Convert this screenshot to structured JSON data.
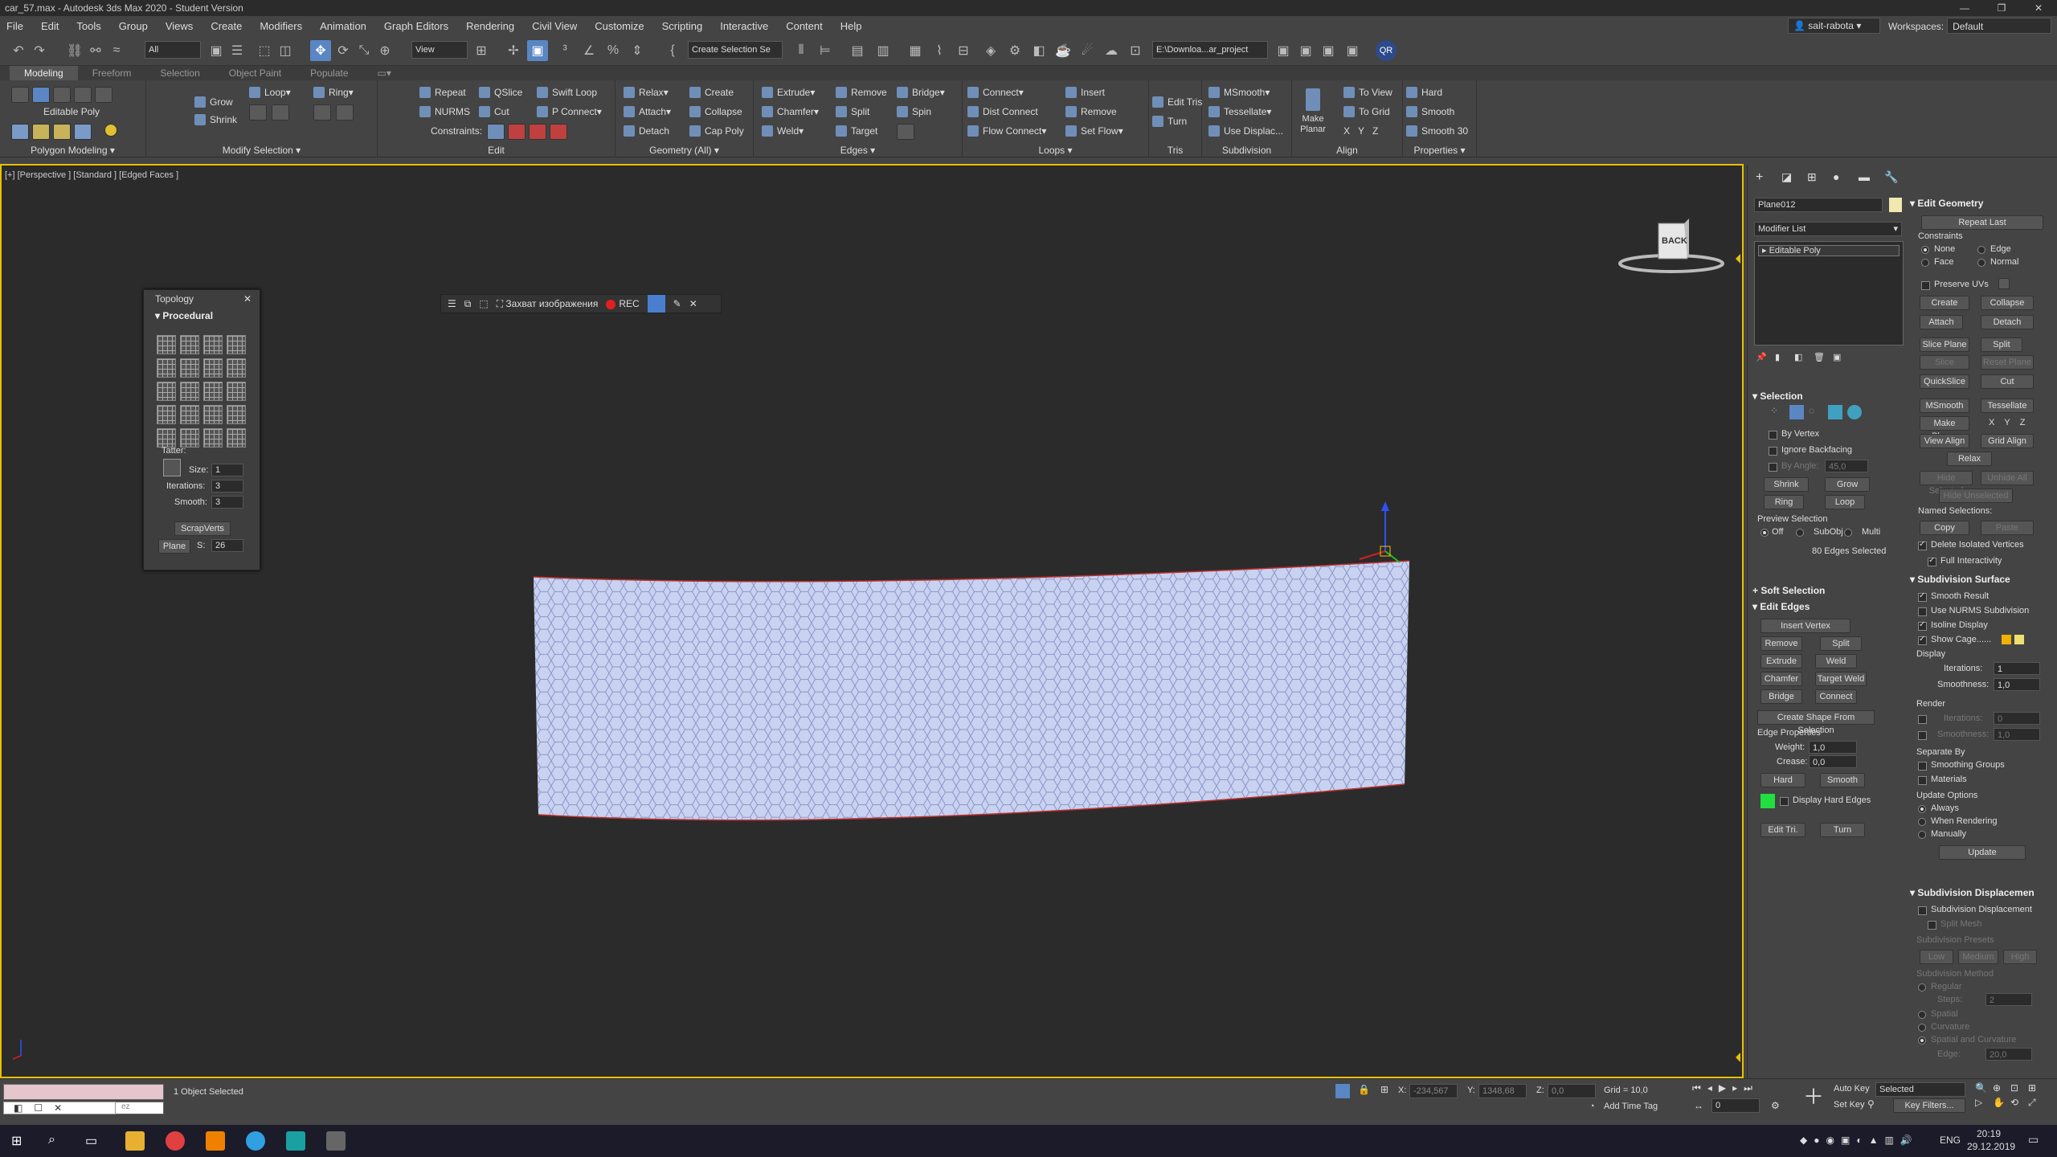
{
  "window": {
    "title": "car_57.max - Autodesk 3ds Max 2020 - Student Version"
  },
  "menu": {
    "items": [
      "File",
      "Edit",
      "Tools",
      "Group",
      "Views",
      "Create",
      "Modifiers",
      "Animation",
      "Graph Editors",
      "Rendering",
      "Civil View",
      "Customize",
      "Scripting",
      "Interactive",
      "Content",
      "Help"
    ],
    "user": "sait-rabota",
    "workspaces_label": "Workspaces:",
    "workspace": "Default"
  },
  "toolbar": {
    "filter": "All",
    "refcoord": "View",
    "selection_set": "Create Selection Se",
    "project_path": "E:\\Downloa...ar_project"
  },
  "ribbon_tabs": [
    "Modeling",
    "Freeform",
    "Selection",
    "Object Paint",
    "Populate"
  ],
  "ribbon": {
    "polygon_modeling": {
      "label": "Polygon Modeling",
      "mode": "Editable Poly"
    },
    "modify_selection": {
      "label": "Modify Selection",
      "grow": "Grow",
      "shrink": "Shrink",
      "loop": "Loop",
      "ring": "Ring"
    },
    "edit": {
      "label": "Edit",
      "repeat": "Repeat",
      "qslice": "QSlice",
      "swift_loop": "Swift Loop",
      "nurms": "NURMS",
      "cut": "Cut",
      "p_connect": "P Connect",
      "constraints": "Constraints:"
    },
    "geometry": {
      "label": "Geometry (All)",
      "relax": "Relax",
      "create": "Create",
      "attach": "Attach",
      "collapse": "Collapse",
      "detach": "Detach",
      "cap_poly": "Cap Poly"
    },
    "edges": {
      "label": "Edges",
      "extrude": "Extrude",
      "remove": "Remove",
      "bridge": "Bridge",
      "chamfer": "Chamfer",
      "split": "Split",
      "spin": "Spin",
      "weld": "Weld",
      "target": "Target"
    },
    "loops": {
      "label": "Loops",
      "connect": "Connect",
      "insert": "Insert",
      "dist_connect": "Dist Connect",
      "remove": "Remove",
      "flow_connect": "Flow Connect",
      "set_flow": "Set Flow"
    },
    "tris": {
      "label": "Tris",
      "edit_tris": "Edit Tris",
      "turn": "Turn"
    },
    "subdivision": {
      "label": "Subdivision",
      "msmooth": "MSmooth",
      "tessellate": "Tessellate",
      "use_displace": "Use Displac..."
    },
    "align": {
      "label": "Align",
      "make_planar": "Make Planar",
      "to_view": "To View",
      "to_grid": "To Grid",
      "x": "X",
      "y": "Y",
      "z": "Z"
    },
    "properties": {
      "label": "Properties",
      "hard": "Hard",
      "smooth": "Smooth",
      "smooth30": "Smooth 30"
    }
  },
  "viewport": {
    "label": "[+] [Perspective ] [Standard ] [Edged Faces ]",
    "navcube_face": "BACK"
  },
  "topology": {
    "title": "Topology",
    "section": "Procedural",
    "tatter": "Tatter:",
    "size_label": "Size:",
    "size": "1",
    "iterations_label": "Iterations:",
    "iterations": "3",
    "smooth_label": "Smooth:",
    "smooth": "3",
    "scrapverts": "ScrapVerts",
    "plane": "Plane",
    "s_label": "S:",
    "s": "26"
  },
  "floatbar": {
    "capture": "Захват изображения",
    "rec": "REC"
  },
  "command_panel": {
    "object_name": "Plane012",
    "modifier_list": "Modifier List",
    "stack_item": "Editable Poly",
    "selection": {
      "title": "Selection",
      "by_vertex": "By Vertex",
      "ignore_backfacing": "Ignore Backfacing",
      "by_angle": "By Angle:",
      "angle": "45,0",
      "shrink": "Shrink",
      "grow": "Grow",
      "ring": "Ring",
      "loop": "Loop",
      "preview": "Preview Selection",
      "off": "Off",
      "subobj": "SubObj",
      "multi": "Multi",
      "status": "80 Edges Selected"
    },
    "soft_selection": "Soft Selection",
    "edit_edges": {
      "title": "Edit Edges",
      "insert_vertex": "Insert Vertex",
      "remove": "Remove",
      "split": "Split",
      "extrude": "Extrude",
      "weld": "Weld",
      "chamfer": "Chamfer",
      "target_weld": "Target Weld",
      "bridge": "Bridge",
      "connect": "Connect",
      "create_shape": "Create Shape From Selection",
      "edge_properties": "Edge Properties",
      "weight_label": "Weight:",
      "weight": "1,0",
      "crease_label": "Crease:",
      "crease": "0,0",
      "hard": "Hard",
      "smooth": "Smooth",
      "display_hard": "Display Hard Edges",
      "edit_tri": "Edit Tri.",
      "turn": "Turn"
    },
    "edit_geometry": {
      "title": "Edit Geometry",
      "repeat_last": "Repeat Last",
      "constraints": "Constraints",
      "none": "None",
      "edge": "Edge",
      "face": "Face",
      "normal": "Normal",
      "preserve_uvs": "Preserve UVs",
      "create": "Create",
      "collapse": "Collapse",
      "attach": "Attach",
      "detach": "Detach",
      "slice_plane": "Slice Plane",
      "split": "Split",
      "slice": "Slice",
      "reset_plane": "Reset Plane",
      "quickslice": "QuickSlice",
      "cut": "Cut",
      "msmooth": "MSmooth",
      "tessellate": "Tessellate",
      "make_planar": "Make Planar",
      "x": "X",
      "y": "Y",
      "z": "Z",
      "view_align": "View Align",
      "grid_align": "Grid Align",
      "relax": "Relax",
      "hide_selected": "Hide Selected",
      "unhide_all": "Unhide All",
      "hide_unselected": "Hide Unselected",
      "named_selections": "Named Selections:",
      "copy": "Copy",
      "paste": "Paste",
      "delete_isolated": "Delete Isolated Vertices",
      "full_interactivity": "Full Interactivity"
    },
    "subdivision_surface": {
      "title": "Subdivision Surface",
      "smooth_result": "Smooth Result",
      "use_nurms": "Use NURMS Subdivision",
      "isoline": "Isoline Display",
      "show_cage": "Show Cage......",
      "display": "Display",
      "iterations_label": "Iterations:",
      "iterations": "1",
      "smoothness_label": "Smoothness:",
      "smoothness": "1,0",
      "render": "Render",
      "r_iterations": "0",
      "r_smoothness": "1,0",
      "separate_by": "Separate By",
      "smoothing_groups": "Smoothing Groups",
      "materials": "Materials",
      "update_options": "Update Options",
      "always": "Always",
      "when_rendering": "When Rendering",
      "manually": "Manually",
      "update": "Update"
    },
    "subdivision_displacement": {
      "title": "Subdivision Displacemen",
      "sub_disp": "Subdivision Displacement",
      "split_mesh": "Split Mesh",
      "presets": "Subdivision Presets",
      "low": "Low",
      "medium": "Medium",
      "high": "High",
      "method": "Subdivision Method",
      "regular": "Regular",
      "steps_label": "Steps:",
      "steps": "2",
      "spatial": "Spatial",
      "curvature": "Curvature",
      "spatial_curvature": "Spatial and Curvature",
      "edge_label": "Edge:",
      "edge": "20,0"
    }
  },
  "statusbar": {
    "maxscript_hint": "ez",
    "selected": "1 Object Selected",
    "x_label": "X:",
    "x": "-234,567",
    "y_label": "Y:",
    "y": "1348,68",
    "z_label": "Z:",
    "z": "0,0",
    "grid": "Grid = 10,0",
    "add_time_tag": "Add Time Tag",
    "auto_key": "Auto Key",
    "selected_dd": "Selected",
    "set_key": "Set Key",
    "key_filters": "Key Filters...",
    "frame": "0"
  },
  "taskbar": {
    "lang": "ENG",
    "time": "20:19",
    "date": "29.12.2019"
  },
  "colors": {
    "accent": "#5a86c4",
    "viewport_border": "#e8c000",
    "mesh": "#c9d2f0"
  }
}
